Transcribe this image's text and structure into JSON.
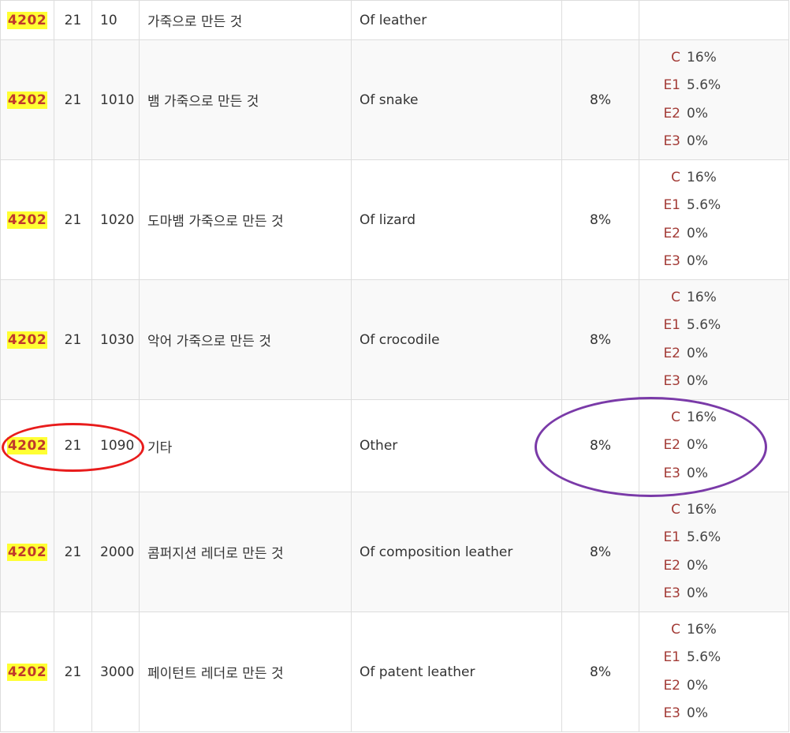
{
  "rows": [
    {
      "hs": "4202",
      "sub": "21",
      "nat": "10",
      "ko": "가죽으로 만든 것",
      "en": "Of leather",
      "rate": "",
      "rates": []
    },
    {
      "hs": "4202",
      "sub": "21",
      "nat": "1010",
      "ko": "뱀 가죽으로 만든 것",
      "en": "Of snake",
      "rate": "8%",
      "rates": [
        {
          "code": "C",
          "value": "16%"
        },
        {
          "code": "E1",
          "value": "5.6%"
        },
        {
          "code": "E2",
          "value": "0%"
        },
        {
          "code": "E3",
          "value": "0%"
        }
      ]
    },
    {
      "hs": "4202",
      "sub": "21",
      "nat": "1020",
      "ko": "도마뱀 가죽으로 만든 것",
      "en": "Of lizard",
      "rate": "8%",
      "rates": [
        {
          "code": "C",
          "value": "16%"
        },
        {
          "code": "E1",
          "value": "5.6%"
        },
        {
          "code": "E2",
          "value": "0%"
        },
        {
          "code": "E3",
          "value": "0%"
        }
      ]
    },
    {
      "hs": "4202",
      "sub": "21",
      "nat": "1030",
      "ko": "악어 가죽으로 만든 것",
      "en": "Of crocodile",
      "rate": "8%",
      "rates": [
        {
          "code": "C",
          "value": "16%"
        },
        {
          "code": "E1",
          "value": "5.6%"
        },
        {
          "code": "E2",
          "value": "0%"
        },
        {
          "code": "E3",
          "value": "0%"
        }
      ]
    },
    {
      "hs": "4202",
      "sub": "21",
      "nat": "1090",
      "ko": "기타",
      "en": "Other",
      "rate": "8%",
      "rates": [
        {
          "code": "C",
          "value": "16%"
        },
        {
          "code": "E2",
          "value": "0%"
        },
        {
          "code": "E3",
          "value": "0%"
        }
      ]
    },
    {
      "hs": "4202",
      "sub": "21",
      "nat": "2000",
      "ko": "콤퍼지션 레더로 만든 것",
      "en": "Of composition leather",
      "rate": "8%",
      "rates": [
        {
          "code": "C",
          "value": "16%"
        },
        {
          "code": "E1",
          "value": "5.6%"
        },
        {
          "code": "E2",
          "value": "0%"
        },
        {
          "code": "E3",
          "value": "0%"
        }
      ]
    },
    {
      "hs": "4202",
      "sub": "21",
      "nat": "3000",
      "ko": "페이턴트 레더로 만든 것",
      "en": "Of patent leather",
      "rate": "8%",
      "rates": [
        {
          "code": "C",
          "value": "16%"
        },
        {
          "code": "E1",
          "value": "5.6%"
        },
        {
          "code": "E2",
          "value": "0%"
        },
        {
          "code": "E3",
          "value": "0%"
        }
      ]
    }
  ],
  "colors": {
    "hs_highlight": "#ffff33",
    "hs_text": "#c0392b",
    "rate_code_text": "#a33b36",
    "annotation_red": "#e81c1c",
    "annotation_purple": "#7a3aa8",
    "row_alt_bg": "#f9f9f9",
    "border": "#dddddd"
  }
}
